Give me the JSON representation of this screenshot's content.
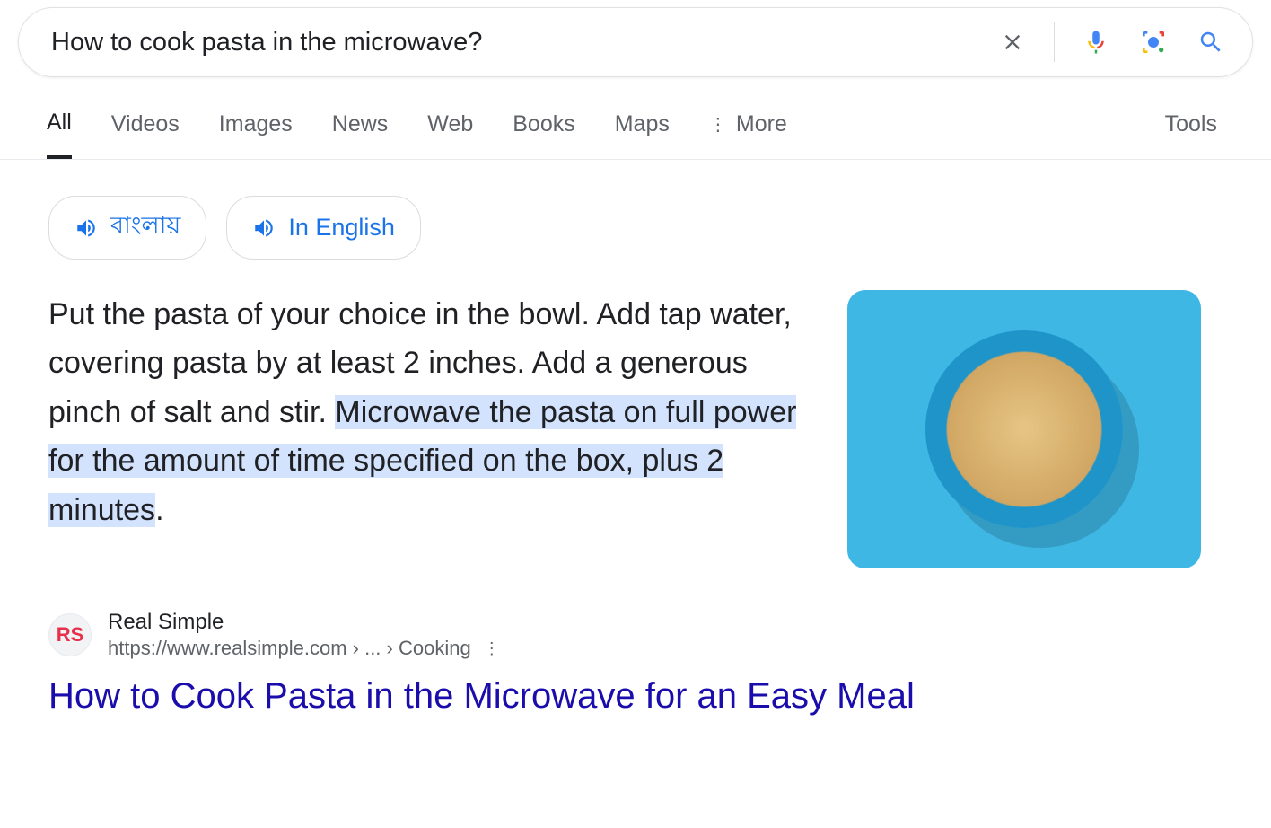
{
  "search": {
    "query": "How to cook pasta in the microwave?"
  },
  "tabs": {
    "all": "All",
    "videos": "Videos",
    "images": "Images",
    "news": "News",
    "web": "Web",
    "books": "Books",
    "maps": "Maps",
    "more": "More",
    "tools": "Tools"
  },
  "language_chips": {
    "bengali": "বাংলায়",
    "english": "In English"
  },
  "featured_snippet": {
    "text_plain": "Put the pasta of your choice in the bowl. Add tap water, covering pasta by at least 2 inches. Add a generous pinch of salt and stir. ",
    "text_highlight": "Microwave the pasta on full power for the amount of time specified on the box, plus 2 minutes",
    "text_after": "."
  },
  "result": {
    "site_name": "Real Simple",
    "favicon_text": "RS",
    "url_display": "https://www.realsimple.com › ... › Cooking",
    "title": "How to Cook Pasta in the Microwave for an Easy Meal"
  },
  "icons": {
    "clear": "clear-icon",
    "mic": "mic-icon",
    "lens": "lens-icon",
    "search": "search-icon",
    "speaker": "speaker-icon",
    "more_vert": "more-vert-icon"
  }
}
